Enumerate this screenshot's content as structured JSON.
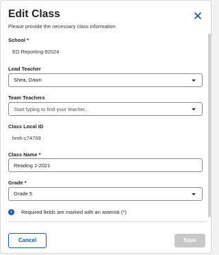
{
  "dialog": {
    "title": "Edit Class",
    "subtitle": "Please provide the necessary class information",
    "close_icon": "close-icon"
  },
  "fields": {
    "school": {
      "label": "School *",
      "value": "ED Reporting-92024"
    },
    "lead_teacher": {
      "label": "Lead Teacher",
      "value": "Shea, Dawn"
    },
    "team_teachers": {
      "label": "Team Teachers",
      "placeholder": "Start typing to find your teacher..."
    },
    "class_local_id": {
      "label": "Class Local ID",
      "value": "hmh-c74769"
    },
    "class_name": {
      "label": "Class Name *",
      "value": "Reading 1-2021"
    },
    "grade": {
      "label": "Grade *",
      "value": "Grade 5"
    }
  },
  "info": {
    "icon": "info-icon",
    "text": "Required fields are marked with an asterisk (*)"
  },
  "footer": {
    "cancel_label": "Cancel",
    "save_label": "Save"
  },
  "colors": {
    "accent": "#1a4f9c",
    "info_icon": "#1a5bb8",
    "disabled_button": "#c8c8c8"
  }
}
